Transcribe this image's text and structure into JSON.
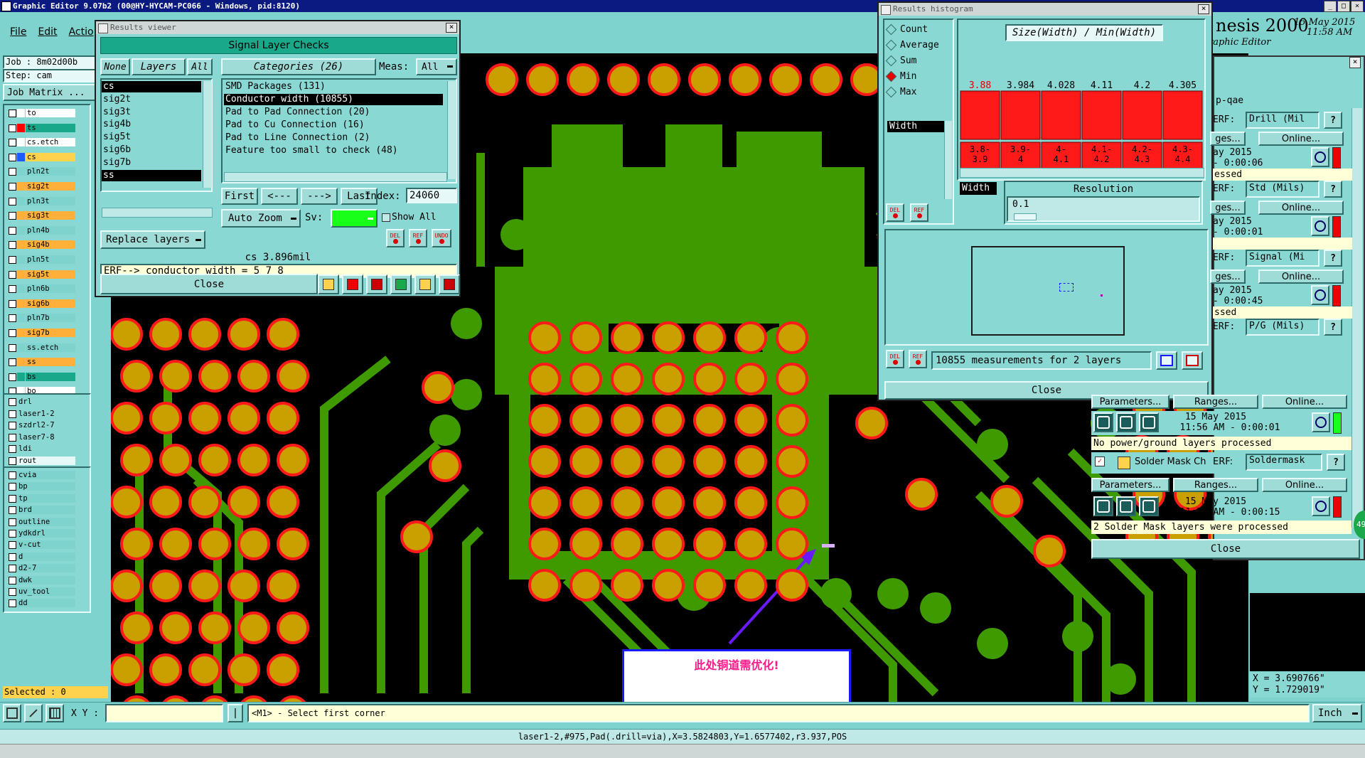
{
  "app": {
    "title": "Graphic Editor 9.07b2 (00@HY-HYCAM-PC066 - Windows, pid:8120)",
    "menu": [
      "File",
      "Edit",
      "Actio"
    ],
    "brand": "nesis 2000",
    "brand_sub": "raphic Editor",
    "date": "15 May 2015",
    "time": "11:58 AM"
  },
  "left_panel": {
    "job": "Job : 8m02d00b",
    "step": "Step: cam",
    "matrix_button": "Job Matrix ...",
    "selected": "Selected : 0",
    "layers": [
      {
        "name": "to",
        "color": "#ffffff",
        "swatch": ""
      },
      {
        "name": "ts",
        "color": "#1aa88a",
        "swatch": "#ff0000"
      },
      {
        "name": "cs.etch",
        "color": "#ffffff",
        "swatch": ""
      },
      {
        "name": "cs",
        "color": "#ffd24d",
        "swatch": "#1a5cff"
      },
      {
        "name": "pln2t",
        "color": "#7fd3cf",
        "swatch": ""
      },
      {
        "name": "sig2t",
        "color": "#ffb03a",
        "swatch": ""
      },
      {
        "name": "pln3t",
        "color": "#7fd3cf",
        "swatch": ""
      },
      {
        "name": "sig3t",
        "color": "#ffb03a",
        "swatch": ""
      },
      {
        "name": "pln4b",
        "color": "#7fd3cf",
        "swatch": ""
      },
      {
        "name": "sig4b",
        "color": "#ffb03a",
        "swatch": ""
      },
      {
        "name": "pln5t",
        "color": "#7fd3cf",
        "swatch": ""
      },
      {
        "name": "sig5t",
        "color": "#ffb03a",
        "swatch": ""
      },
      {
        "name": "pln6b",
        "color": "#7fd3cf",
        "swatch": ""
      },
      {
        "name": "sig6b",
        "color": "#ffb03a",
        "swatch": ""
      },
      {
        "name": "pln7b",
        "color": "#7fd3cf",
        "swatch": ""
      },
      {
        "name": "sig7b",
        "color": "#ffb03a",
        "swatch": ""
      },
      {
        "name": "ss.etch",
        "color": "#7fd3cf",
        "swatch": ""
      },
      {
        "name": "ss",
        "color": "#ffb03a",
        "swatch": ""
      },
      {
        "name": "bs",
        "color": "#1aa88a",
        "swatch": ""
      },
      {
        "name": "bo",
        "color": "#ffffff",
        "swatch": ""
      }
    ],
    "drill_layers": [
      "drl",
      "laser1-2",
      "szdrl2-7",
      "laser7-8",
      "ldi",
      "rout"
    ],
    "other_layers": [
      "cvia",
      "bp",
      "tp",
      "brd",
      "outline",
      "ydkdrl",
      "v-cut",
      "d",
      "d2-7",
      "dwk",
      "uv_tool",
      "dd"
    ]
  },
  "results_viewer": {
    "title": "Results viewer",
    "header": "Signal Layer Checks",
    "none_btn": "None",
    "layers_btn": "Layers",
    "all_btn": "All",
    "categories_label": "Categories (26)",
    "meas_label": "Meas:",
    "meas_value": "All",
    "layer_items": [
      "cs",
      "sig2t",
      "sig3t",
      "sig4b",
      "sig5t",
      "sig6b",
      "sig7b",
      "ss"
    ],
    "categories": [
      "SMD Packages (131)",
      "Conductor width (10855)",
      "Pad to Pad Connection (20)",
      "Pad to Cu Connection (16)",
      "Pad to Line Connection (2)",
      "Feature too small to check (48)"
    ],
    "nav": [
      "First",
      "<---",
      "--->",
      "Last"
    ],
    "index_label": "Index:",
    "index_value": "24060",
    "auto_zoom": "Auto Zoom",
    "sv_label": "Sv:",
    "show_all": "Show All",
    "replace_layers": "Replace layers",
    "del": "DEL",
    "ref": "REF",
    "undo": "UNDO",
    "status": "cs 3.896mil",
    "erf": "ERF--> conductor_width = 5 7 8",
    "close": "Close"
  },
  "histogram": {
    "title": "Results histogram",
    "options": [
      "Count",
      "Average",
      "Sum",
      "Min",
      "Max"
    ],
    "selected_option": "Min",
    "field": "Width",
    "chart_title": "Size(Width) / Min(Width)",
    "x_field": "Width",
    "resolution_label": "Resolution",
    "resolution_value": "0.1",
    "status": "10855 measurements for 2 layers",
    "close": "Close",
    "del": "DEL",
    "ref": "REF"
  },
  "chart_data": {
    "type": "bar",
    "title": "Size(Width) / Min(Width)",
    "categories": [
      "3.8-3.9",
      "3.9-4",
      "4-4.1",
      "4.1-4.2",
      "4.2-4.3",
      "4.3-4.4"
    ],
    "values": [
      3.88,
      3.984,
      4.028,
      4.11,
      4.2,
      4.305
    ],
    "value_labels": [
      "3.88",
      "3.984",
      "4.028",
      "4.11",
      "4.2",
      "4.305"
    ],
    "category_labels": [
      "3.8-\n3.9",
      "3.9-\n4",
      "4-\n4.1",
      "4.1-\n4.2",
      "4.2-\n4.3",
      "4.3-\n4.4"
    ],
    "colors": {
      "bar": "#ff1a1a",
      "first_label": "#e00000"
    }
  },
  "right_panel": {
    "title_frag": "p-qae",
    "rows": [
      {
        "erf": "ERF:",
        "param": "Drill (Mil",
        "ges": "ges...",
        "online": "Online...",
        "date": "ay 2015",
        "time": "- 0:00:06",
        "msg": "essed"
      },
      {
        "erf": "ERF:",
        "param": "Std (Mils)",
        "ges": "ges...",
        "online": "Online...",
        "date": "ay 2015",
        "time": "- 0:00:01",
        "msg": ""
      },
      {
        "erf": "ERF:",
        "param": "Signal (Mi",
        "ges": "ges...",
        "online": "Online...",
        "date": "ay 2015",
        "time": "- 0:00:45",
        "msg": "ssed"
      },
      {
        "erf": "ERF:",
        "param": "P/G (Mils)",
        "ges": "",
        "online": "",
        "date": "",
        "time": "",
        "msg": ""
      }
    ],
    "pg_params": "Parameters...",
    "pg_ranges": "Ranges...",
    "pg_online": "Online...",
    "pg_date": "15 May 2015",
    "pg_time": "11:56 AM - 0:00:01",
    "pg_msg": "No power/ground layers processed",
    "sm_label": "Solder Mask Ch",
    "sm_erf": "ERF:",
    "sm_param": "Soldermask",
    "sm_params": "Parameters...",
    "sm_ranges": "Ranges...",
    "sm_online": "Online...",
    "sm_date": "15 May 2015",
    "sm_time": "11:57 AM - 0:00:15",
    "sm_msg": "2 Solder Mask layers were processed",
    "close": "Close",
    "help": "?"
  },
  "canvas": {
    "annotation": "此处铜道需优化!",
    "coord_x": "X = 3.690766\"",
    "coord_y": "Y = 1.729019\""
  },
  "bottom": {
    "xy_label": "X Y :",
    "xy_value": "",
    "prompt": "<M1> - Select first corner",
    "units": "Inch",
    "status": "laser1-2,#975,Pad(.drill=via),X=3.5824803,Y=1.6577402,r3.937,POS",
    "badge": "49"
  }
}
